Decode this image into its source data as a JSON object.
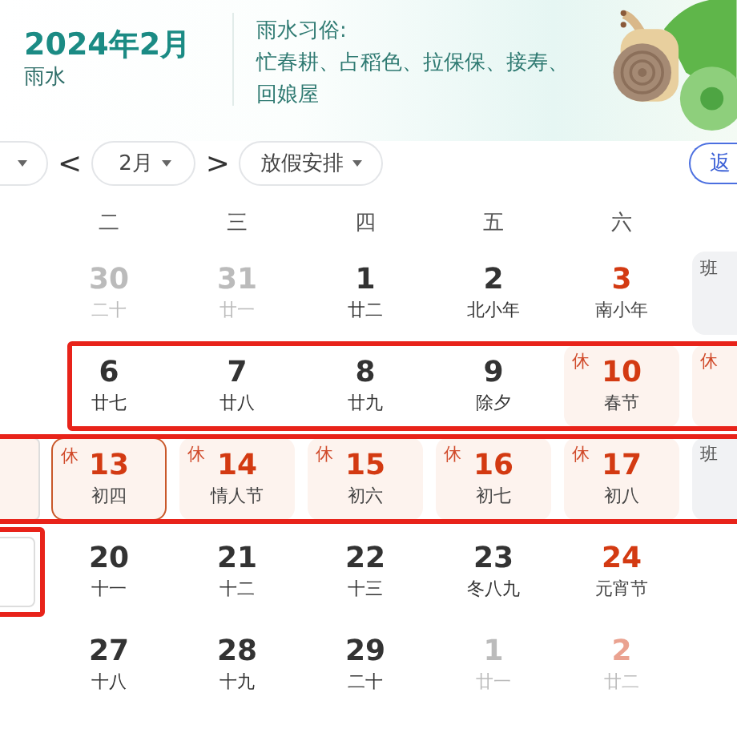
{
  "header": {
    "title": "2024年2月",
    "solar_term": "雨水",
    "customs_label": "雨水习俗:",
    "customs": "忙春耕、占稻色、拉保保、接寿、回娘屋"
  },
  "toolbar": {
    "prev": "<",
    "month_dropdown": "2月",
    "next": ">",
    "holiday_dropdown": "放假安排",
    "back_button": "返"
  },
  "weekdays": [
    "二",
    "三",
    "四",
    "五",
    "六"
  ],
  "weeks": [
    {
      "highlighted": false,
      "cells": [
        {
          "selected": false,
          "framed": false
        },
        {
          "day": "30",
          "lunar": "二十",
          "muted": true,
          "red": false,
          "selected": false
        },
        {
          "day": "31",
          "lunar": "廿一",
          "muted": true,
          "red": false,
          "selected": false
        },
        {
          "day": "1",
          "lunar": "廿二",
          "muted": false,
          "red": false,
          "selected": false
        },
        {
          "day": "2",
          "lunar": "北小年",
          "muted": false,
          "red": false,
          "selected": false
        },
        {
          "day": "3",
          "lunar": "南小年",
          "muted": false,
          "red": true,
          "selected": false
        },
        {
          "badge": "班",
          "holiday": false,
          "selected": false
        }
      ]
    },
    {
      "highlighted": true,
      "cells": [
        {
          "selected": false,
          "framed": false
        },
        {
          "day": "6",
          "lunar": "廿七",
          "muted": false,
          "red": false,
          "selected": false
        },
        {
          "day": "7",
          "lunar": "廿八",
          "muted": false,
          "red": false,
          "selected": false
        },
        {
          "day": "8",
          "lunar": "廿九",
          "muted": false,
          "red": false,
          "selected": false
        },
        {
          "day": "9",
          "lunar": "除夕",
          "muted": false,
          "red": false,
          "selected": false
        },
        {
          "day": "10",
          "lunar": "春节",
          "badge": "休",
          "muted": false,
          "red": true,
          "holiday": true,
          "selected": false
        },
        {
          "badge": "休",
          "holiday": true,
          "selected": false
        }
      ]
    },
    {
      "highlighted": true,
      "cells": [
        {
          "holiday": true,
          "selected": false,
          "framed": true
        },
        {
          "day": "13",
          "lunar": "初四",
          "badge": "休",
          "muted": false,
          "red": true,
          "holiday": true,
          "selected": true
        },
        {
          "day": "14",
          "lunar": "情人节",
          "badge": "休",
          "muted": false,
          "red": true,
          "holiday": true,
          "selected": false
        },
        {
          "day": "15",
          "lunar": "初六",
          "badge": "休",
          "muted": false,
          "red": true,
          "holiday": true,
          "selected": false
        },
        {
          "day": "16",
          "lunar": "初七",
          "badge": "休",
          "muted": false,
          "red": true,
          "holiday": true,
          "selected": false
        },
        {
          "day": "17",
          "lunar": "初八",
          "badge": "休",
          "muted": false,
          "red": true,
          "holiday": true,
          "selected": false
        },
        {
          "badge": "班",
          "holiday": false,
          "selected": false
        }
      ]
    },
    {
      "highlighted": false,
      "cells": [
        {
          "selected": false,
          "framed": true
        },
        {
          "day": "20",
          "lunar": "十一",
          "muted": false,
          "red": false,
          "selected": false
        },
        {
          "day": "21",
          "lunar": "十二",
          "muted": false,
          "red": false,
          "selected": false
        },
        {
          "day": "22",
          "lunar": "十三",
          "muted": false,
          "red": false,
          "selected": false
        },
        {
          "day": "23",
          "lunar": "冬八九",
          "muted": false,
          "red": false,
          "selected": false
        },
        {
          "day": "24",
          "lunar": "元宵节",
          "muted": false,
          "red": true,
          "selected": false
        },
        {
          "selected": false
        }
      ]
    },
    {
      "highlighted": false,
      "cells": [
        {
          "selected": false,
          "framed": false
        },
        {
          "day": "27",
          "lunar": "十八",
          "muted": false,
          "red": false,
          "selected": false
        },
        {
          "day": "28",
          "lunar": "十九",
          "muted": false,
          "red": false,
          "selected": false
        },
        {
          "day": "29",
          "lunar": "二十",
          "muted": false,
          "red": false,
          "selected": false
        },
        {
          "day": "1",
          "lunar": "廿一",
          "muted": true,
          "red": false,
          "selected": false
        },
        {
          "day": "2",
          "lunar": "廿二",
          "muted": true,
          "red": true,
          "selected": false
        },
        {
          "selected": false
        }
      ]
    }
  ]
}
